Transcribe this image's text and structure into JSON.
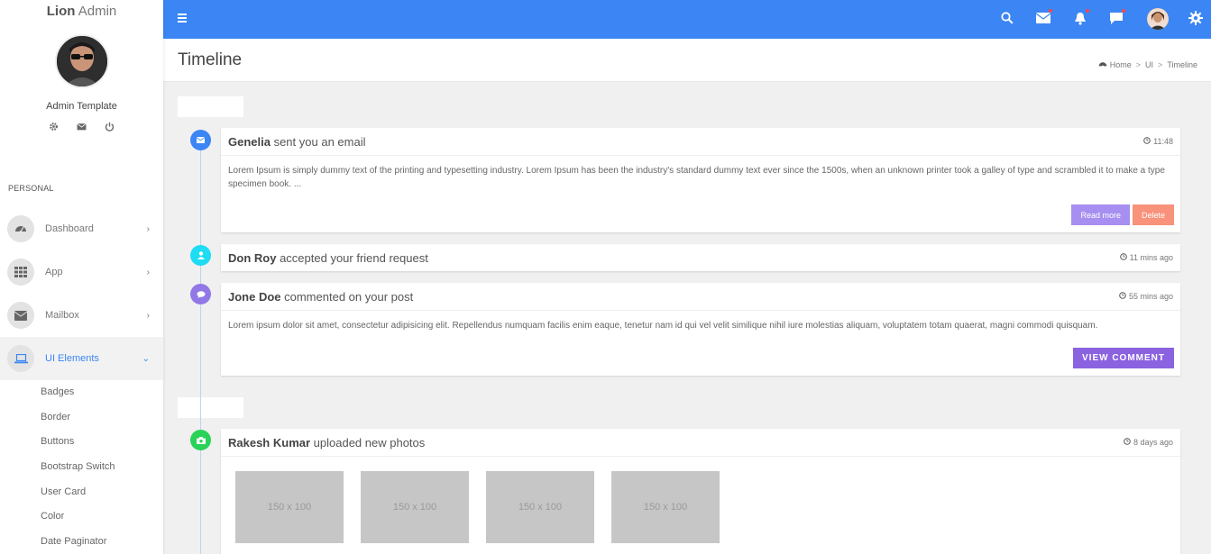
{
  "brand": {
    "bold": "Lion",
    "rest": " Admin"
  },
  "profile": {
    "name": "Admin Template"
  },
  "sidebar": {
    "section": "PERSONAL",
    "items": [
      {
        "label": "Dashboard",
        "icon": "dashboard-icon"
      },
      {
        "label": "App",
        "icon": "grid-icon"
      },
      {
        "label": "Mailbox",
        "icon": "envelope-icon"
      },
      {
        "label": "UI Elements",
        "icon": "laptop-icon"
      }
    ],
    "submenu": [
      "Badges",
      "Border",
      "Buttons",
      "Bootstrap Switch",
      "User Card",
      "Color",
      "Date Paginator"
    ]
  },
  "header": {
    "title": "Timeline",
    "breadcrumb": [
      "Home",
      "UI",
      "Timeline"
    ]
  },
  "colors": {
    "accent": "#3b86f4",
    "blue": "#3b86f4",
    "cyan": "#1ddcf3",
    "purple": "#9178e6",
    "green": "#2ad25a"
  },
  "timeline": [
    {
      "name": "Genelia",
      "action": " sent you an email",
      "time": "11:48",
      "body": "Lorem Ipsum is simply dummy text of the printing and typesetting industry. Lorem Ipsum has been the industry's standard dummy text ever since the 1500s, when an unknown printer took a galley of type and scrambled it to make a type specimen book. ...",
      "btn1": "Read more",
      "btn2": "Delete"
    },
    {
      "name": "Don Roy",
      "action": " accepted your friend request",
      "time": "11 mins ago"
    },
    {
      "name": "Jone Doe",
      "action": " commented on your post",
      "time": "55 mins ago",
      "body": "Lorem ipsum dolor sit amet, consectetur adipisicing elit. Repellendus numquam facilis enim eaque, tenetur nam id qui vel velit similique nihil iure molestias aliquam, voluptatem totam quaerat, magni commodi quisquam.",
      "btn1": "VIEW COMMENT"
    },
    {
      "name": "Rakesh Kumar",
      "action": " uploaded new photos",
      "time": "8 days ago",
      "photos": [
        "150 x 100",
        "150 x 100",
        "150 x 100",
        "150 x 100"
      ]
    }
  ]
}
